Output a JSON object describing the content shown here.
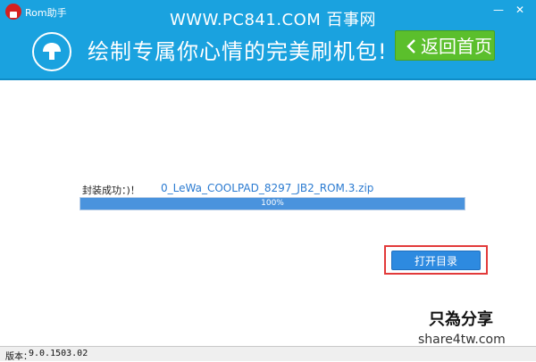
{
  "window": {
    "title": "Rom助手"
  },
  "watermark": {
    "text": "WWW.PC841.COM 百事网"
  },
  "banner": {
    "slogan": "绘制专属你心情的完美刷机包!",
    "back_label": "返回首页"
  },
  "content": {
    "status_label": "封装成功：)！",
    "filename": "0_LeWa_COOLPAD_8297_JB2_ROM.3.zip",
    "progress": {
      "percent": 100,
      "text": "100%"
    },
    "open_dir_label": "打开目录"
  },
  "brand": {
    "name": "只為分享",
    "url": "share4tw.com"
  },
  "statusbar": {
    "version_label": "版本：",
    "version_value": "9.0.1503.02"
  },
  "colors": {
    "header": "#1aa2df",
    "back_button": "#5bbf2c",
    "progress_fill": "#4a93dd",
    "highlight": "#e23a3a"
  }
}
